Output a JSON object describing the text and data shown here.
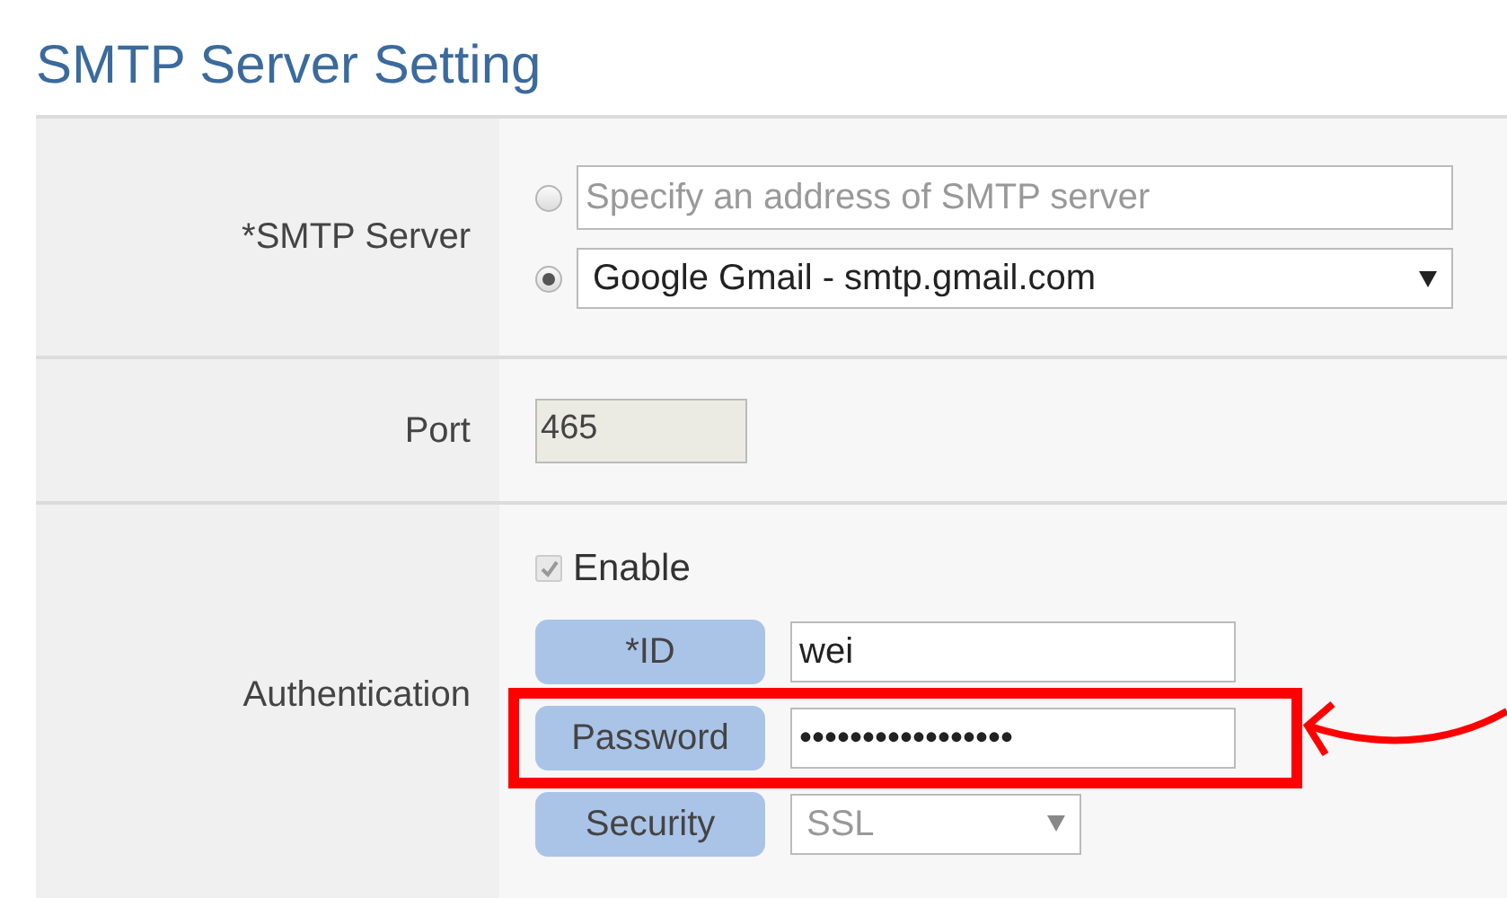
{
  "title": "SMTP Server Setting",
  "smtp_server": {
    "label": "*SMTP Server",
    "options": [
      {
        "kind": "text",
        "selected": false,
        "placeholder": "Specify an address of SMTP server"
      },
      {
        "kind": "select",
        "selected": true,
        "value": "Google Gmail - smtp.gmail.com"
      }
    ]
  },
  "port": {
    "label": "Port",
    "value": "465",
    "disabled": true
  },
  "authentication": {
    "label": "Authentication",
    "enable": {
      "label": "Enable",
      "checked": true,
      "disabled": true
    },
    "fields": [
      {
        "kind": "text",
        "label": "*ID",
        "value": "wei",
        "highlighted": false
      },
      {
        "kind": "password",
        "label": "Password",
        "value": "•••••••••••••••••",
        "highlighted": true
      },
      {
        "kind": "select",
        "label": "Security",
        "value": "SSL",
        "disabled": true,
        "highlighted": false
      }
    ]
  }
}
